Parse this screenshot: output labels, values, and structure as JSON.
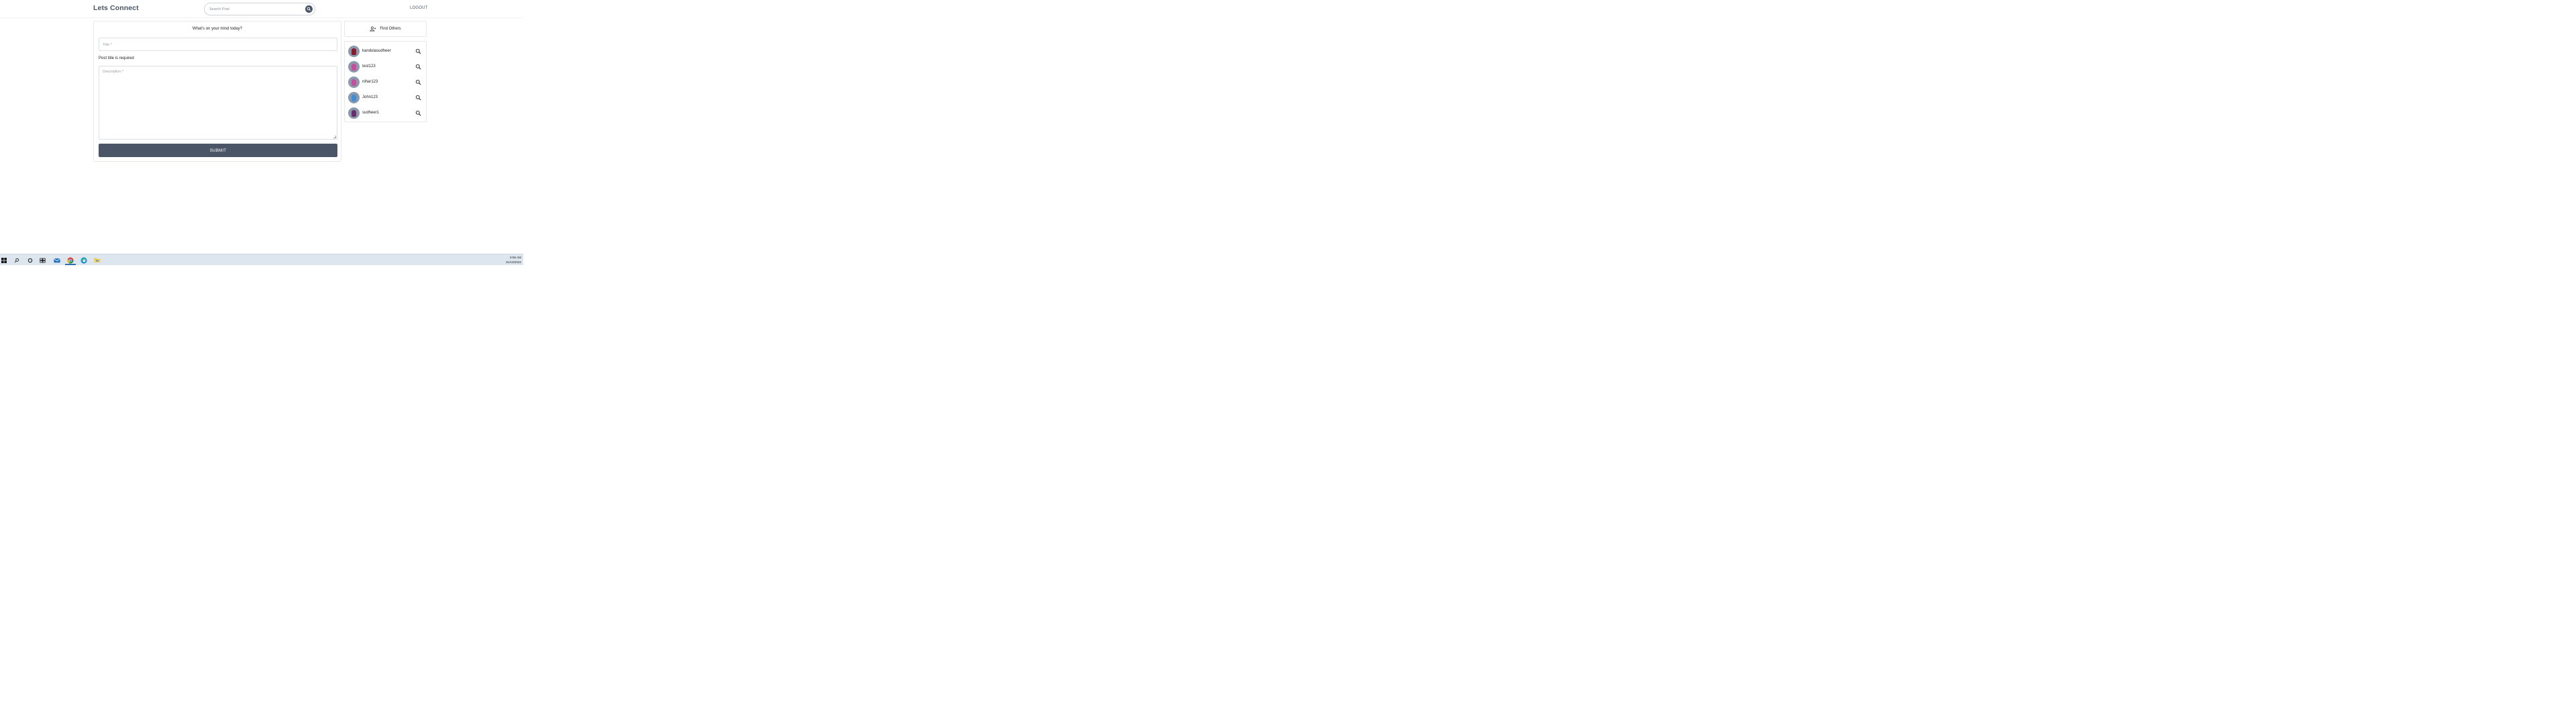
{
  "header": {
    "brand": "Lets Connect",
    "search_placeholder": "Search Post",
    "logout_label": "LOGOUT"
  },
  "post_form": {
    "heading": "What's on your mind today?",
    "title_placeholder": "Title *",
    "title_error": "Post title is required",
    "description_placeholder": "Description *",
    "submit_label": "SUBMIT"
  },
  "sidebar": {
    "find_others_label": "Find Others",
    "users": [
      {
        "name": "kandulasudheer",
        "avatar_color": "#8b1a2a"
      },
      {
        "name": "test123",
        "avatar_color": "#d04a9a"
      },
      {
        "name": "nihar123",
        "avatar_color": "#c84f9e"
      },
      {
        "name": "John123",
        "avatar_color": "#3f8fd6"
      },
      {
        "name": "sudheer1",
        "avatar_color": "#6a2f6a"
      }
    ]
  },
  "taskbar": {
    "icons": [
      "windows-start-icon",
      "search-icon",
      "cortana-icon",
      "task-view-icon",
      "mail-icon",
      "chrome-icon",
      "edge-icon",
      "file-explorer-icon"
    ],
    "time": "6:56 AM",
    "date": "31/10/2022"
  },
  "colors": {
    "primary": "#4a5568",
    "taskbar": "#dde6ee"
  }
}
